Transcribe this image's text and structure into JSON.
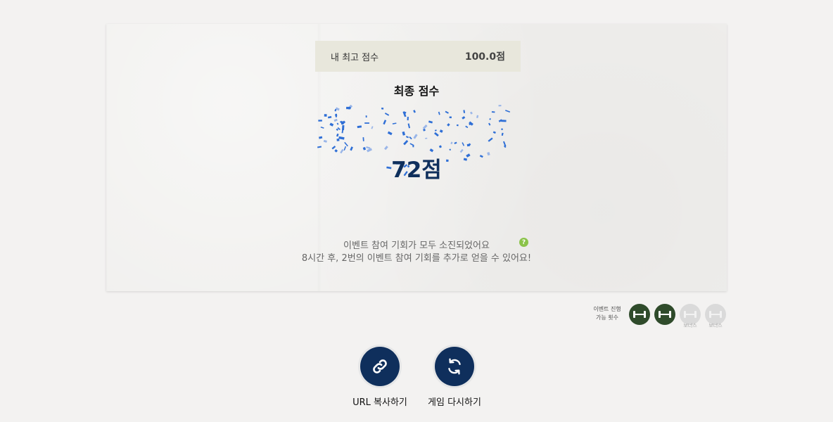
{
  "best_score": {
    "label": "내 최고 점수",
    "value": "100.0점"
  },
  "final": {
    "title": "최종 점수",
    "score": "72점"
  },
  "messages": {
    "line1": "이벤트 참여 기회가 모두 소진되었어요",
    "line2": "8시간 후, 2번의 이벤트 참여 기회를 추가로 얻을 수 있어요!"
  },
  "help_icon": {
    "name": "question-icon",
    "glyph": "?"
  },
  "chances": {
    "label_line1": "이벤트 진행",
    "label_line2": "가능 횟수",
    "items": [
      {
        "state": "used",
        "icon": "dumbbell-icon",
        "sub": ""
      },
      {
        "state": "used",
        "icon": "dumbbell-icon",
        "sub": ""
      },
      {
        "state": "bonus",
        "icon": "dumbbell-icon",
        "sub": "보너스"
      },
      {
        "state": "bonus",
        "icon": "dumbbell-icon",
        "sub": "보너스"
      }
    ]
  },
  "actions": {
    "copy_url": {
      "label": "URL 복사하기",
      "icon": "link-icon"
    },
    "replay": {
      "label": "게임 다시하기",
      "icon": "refresh-icon"
    }
  },
  "colors": {
    "navy": "#0f2f5c",
    "confetti_blue": "#2f6fd6",
    "confetti_light": "#9ab6e8",
    "chip_green": "#2f4b2b",
    "help_green": "#8bc34a"
  }
}
